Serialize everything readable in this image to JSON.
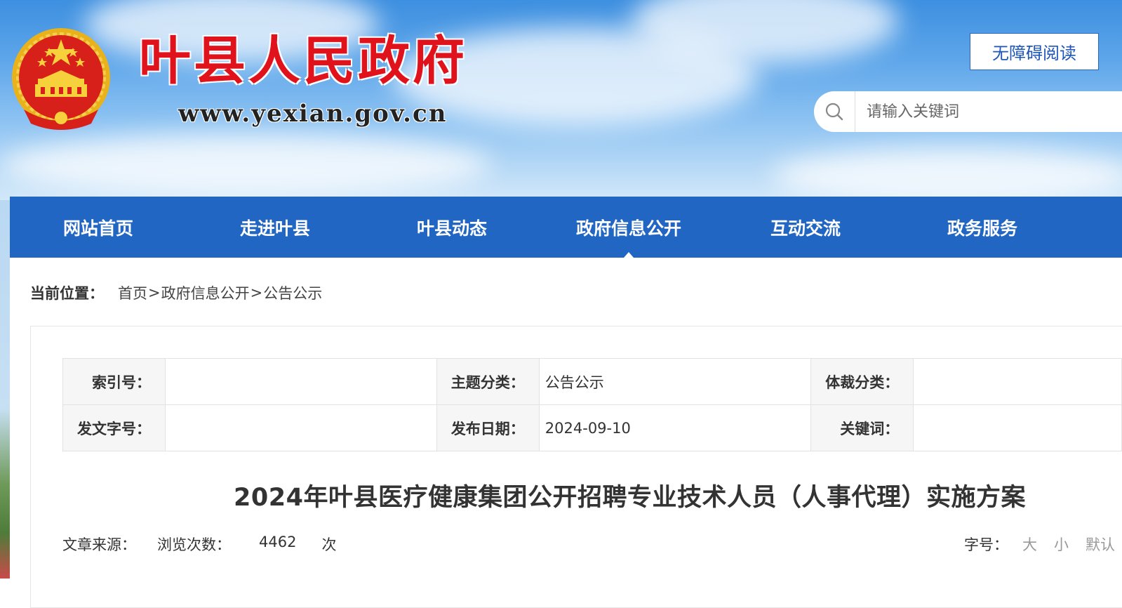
{
  "header": {
    "site_title": "叶县人民政府",
    "site_url": "www.yexian.gov.cn",
    "accessibility_label": "无障碍阅读",
    "search_placeholder": "请输入关键词"
  },
  "nav": {
    "items": [
      "网站首页",
      "走进叶县",
      "叶县动态",
      "政府信息公开",
      "互动交流",
      "政务服务"
    ],
    "active": "政府信息公开"
  },
  "breadcrumb": {
    "label": "当前位置：",
    "items": [
      "首页",
      "政府信息公开",
      "公告公示"
    ],
    "separator": ">"
  },
  "meta_table": {
    "rows": [
      [
        {
          "key": "索引号：",
          "value": ""
        },
        {
          "key": "主题分类：",
          "value": "公告公示"
        },
        {
          "key": "体裁分类：",
          "value": ""
        }
      ],
      [
        {
          "key": "发文字号：",
          "value": ""
        },
        {
          "key": "发布日期：",
          "value": "2024-09-10"
        },
        {
          "key": "关键词：",
          "value": ""
        }
      ]
    ]
  },
  "article": {
    "title": "2024年叶县医疗健康集团公开招聘专业技术人员（人事代理）实施方案",
    "source_label": "文章来源：",
    "source_value": "",
    "views_label": "浏览次数：",
    "views_value": "4462",
    "views_unit": "次"
  },
  "font_size": {
    "label": "字号：",
    "options": [
      "大",
      "小",
      "默认"
    ]
  },
  "colors": {
    "nav_bg": "#2166c3",
    "title_red": "#e0121b",
    "accent_blue": "#1e56b8"
  },
  "icons": {
    "search": "search-icon",
    "emblem": "national-emblem-icon"
  }
}
